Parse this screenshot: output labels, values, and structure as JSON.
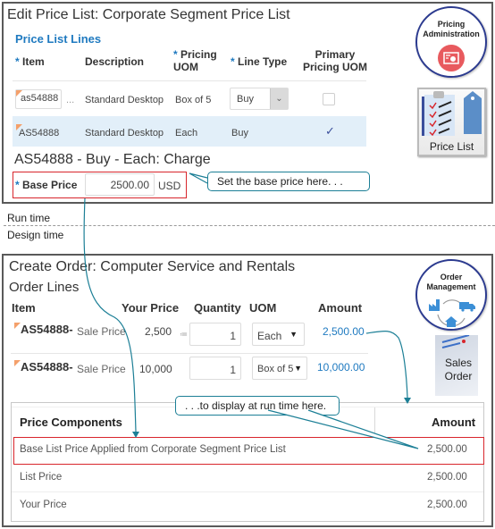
{
  "top_panel": {
    "title": "Edit Price List: Corporate Segment Price List",
    "section_title": "Price List Lines",
    "headers": {
      "item": "Item",
      "description": "Description",
      "pricing_uom": "Pricing UOM",
      "line_type": "Line Type",
      "primary_pricing_uom": "Primary Pricing UOM",
      "required_marker": "*"
    },
    "rows": [
      {
        "item": "as54888",
        "item_more": "...",
        "description": "Standard Desktop",
        "pricing_uom": "Box of 5",
        "line_type": "Buy",
        "primary": false
      },
      {
        "item": "AS54888",
        "description": "Standard Desktop",
        "pricing_uom": "Each",
        "line_type": "Buy",
        "primary": true,
        "check_glyph": "✓"
      }
    ],
    "charge_title": "AS54888 - Buy - Each: Charge",
    "base_price_label": "Base Price",
    "base_price_value": "2500.00",
    "currency": "USD",
    "callout": "Set the base price here. . ."
  },
  "badges": {
    "pricing": {
      "label": "Pricing Administration",
      "icon": "pricing-icon",
      "color": "#e85a5e"
    },
    "price_list_tile": {
      "label": "Price List",
      "icon": "clipboard-tag-icon"
    },
    "order_mgmt": {
      "label": "Order Management",
      "icon": "factory-truck-home-icon",
      "color": "#3c8fd6"
    },
    "sales_order_tile": {
      "label": "Sales Order",
      "icon": "document-icon"
    }
  },
  "divider": {
    "run_time": "Run time",
    "design_time": "Design time"
  },
  "bottom_panel": {
    "title": "Create Order: Computer Service and Rentals",
    "section_title": "Order Lines",
    "headers": {
      "item": "Item",
      "your_price": "Your Price",
      "quantity": "Quantity",
      "uom": "UOM",
      "amount": "Amount"
    },
    "rows": [
      {
        "item": "AS54888-",
        "price_type": "Sale Price",
        "your_price": "2,500",
        "quantity": "1",
        "uom": "Each",
        "amount": "2,500.00"
      },
      {
        "item": "AS54888-",
        "price_type": "Sale Price",
        "your_price": "10,000",
        "quantity": "1",
        "uom": "Box of 5",
        "amount": "10,000.00"
      }
    ],
    "callout": ". . .to display at run time here.",
    "price_components": {
      "header_component": "Price Components",
      "header_amount": "Amount",
      "rows": [
        {
          "label": "Base List Price Applied from Corporate Segment Price List",
          "amount": "2,500.00"
        },
        {
          "label": "List Price",
          "amount": "2,500.00"
        },
        {
          "label": "Your Price",
          "amount": "2,500.00"
        }
      ]
    }
  },
  "colors": {
    "accent_blue": "#1f7ac0",
    "highlight_red": "#d8262c",
    "connector_teal": "#1c7f96",
    "row_highlight": "#e2eff9",
    "flag_orange": "#f4a06b"
  }
}
